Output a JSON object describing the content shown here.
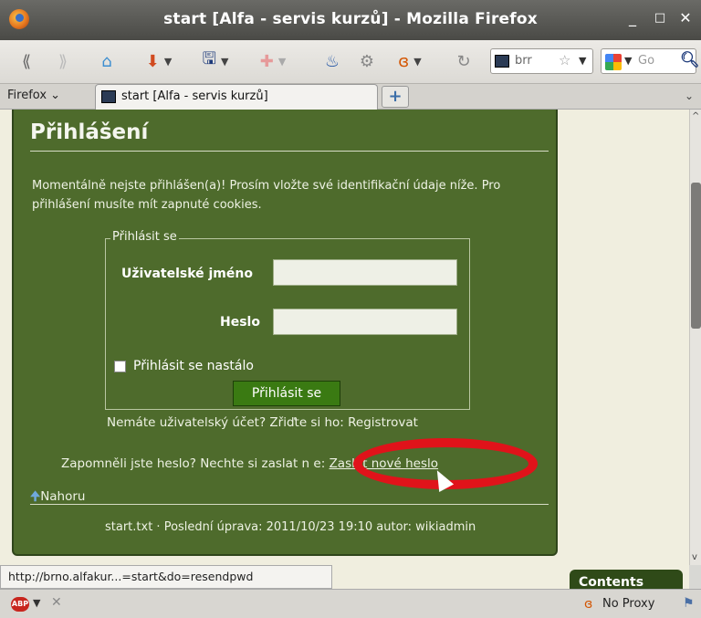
{
  "window": {
    "title": "start [Alfa - servis kurzů] - Mozilla Firefox",
    "minimize": "_",
    "maximize": "□",
    "close": "✕"
  },
  "toolbar": {
    "back_icon": "back-arrow-icon",
    "address_text": "brr",
    "search_text": "Go"
  },
  "tabs": {
    "menu_label": "Firefox",
    "active_tab": "start [Alfa - servis kurzů]",
    "new_tab": "+"
  },
  "page": {
    "heading": "Přihlášení",
    "intro": "Momentálně nejste přihlášen(a)! Prosím vložte své identifikační údaje níže. Pro přihlášení musíte mít zapnuté cookies.",
    "fieldset_legend": "Přihlásit se",
    "username_label": "Uživatelské jméno",
    "username_value": "",
    "password_label": "Heslo",
    "password_value": "",
    "remember_label": "Přihlásit se nastálo",
    "remember_checked": false,
    "login_button": "Přihlásit se",
    "register_text": "Nemáte uživatelský účet? Zřiďte si ho: Registrovat",
    "forgot_text": "Zapomněli jste heslo? Nechte si zaslat n",
    "forgot_text_tail": "e: ",
    "forgot_link": "Zaslat nové heslo",
    "top_link": "Nahoru",
    "footer": "start.txt · Poslední úprava: 2011/10/23 19:10 autor: wikiadmin"
  },
  "status": {
    "link_url": "http://brno.alfakur...=start&do=resendpwd",
    "contents_button": "Contents",
    "proxy": "No Proxy"
  },
  "colors": {
    "panel": "#4e6b2c",
    "page_bg": "#f0eedf",
    "annotation": "#e0131a",
    "button": "#3a7a12"
  }
}
